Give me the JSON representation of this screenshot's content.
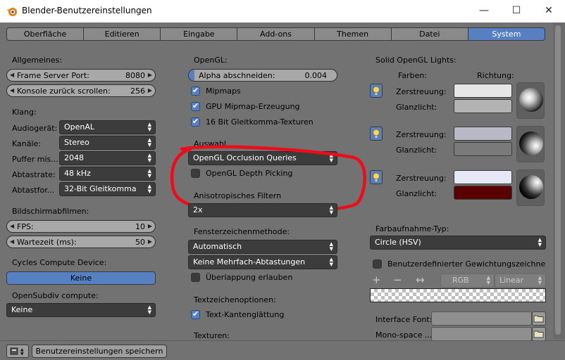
{
  "window": {
    "title": "Blender-Benutzereinstellungen",
    "minimize": "—",
    "maximize": "☐",
    "close": "✕"
  },
  "tabs": [
    "Oberfläche",
    "Editieren",
    "Eingabe",
    "Add-ons",
    "Themen",
    "Datei",
    "System"
  ],
  "active_tab": "System",
  "left": {
    "general_heading": "Allgemeines:",
    "frame_server_port": {
      "label": "Frame Server Port:",
      "value": "8080"
    },
    "console_scroll": {
      "label": "Konsole zurück scrollen:",
      "value": "256"
    },
    "sound_heading": "Klang:",
    "audio_device": {
      "label": "Audiogerät:",
      "value": "OpenAL"
    },
    "channels": {
      "label": "Kanäle:",
      "value": "Stereo"
    },
    "buffer": {
      "label": "Puffer mis...",
      "value": "2048"
    },
    "sample_rate": {
      "label": "Abtastrate:",
      "value": "48 kHz"
    },
    "sample_format": {
      "label": "Abtastfor...",
      "value": "32-Bit Gleitkomma"
    },
    "screencast_heading": "Bildschirmabfilmen:",
    "fps": {
      "label": "FPS:",
      "value": "10"
    },
    "wait_time": {
      "label": "Wartezeit (ms):",
      "value": "50"
    },
    "cycles_heading": "Cycles Compute Device:",
    "cycles_button": "Keine",
    "opensubdiv_heading": "OpenSubdiv compute:",
    "opensubdiv_value": "Keine"
  },
  "middle": {
    "opengl_heading": "OpenGL:",
    "alpha_clip": {
      "label": "Alpha abschneiden:",
      "value": "0.004"
    },
    "mipmaps": "Mipmaps",
    "gpu_mipmap": "GPU Mipmap-Erzeugung",
    "float_textures": "16 Bit Gleitkomma-Texturen",
    "selection_heading": "Auswahl",
    "selection_value": "OpenGL Occlusion Queries",
    "depth_picking": "OpenGL Depth Picking",
    "aniso_heading": "Anisotropisches Filtern",
    "aniso_value": "2x",
    "window_draw_heading": "Fensterzeichenmethode:",
    "window_draw_value": "Automatisch",
    "multisample_value": "Keine Mehrfach-Abtastungen",
    "overlap": "Überlappung erlauben",
    "text_draw_heading": "Textzeichenoptionen:",
    "text_antialias": "Text-Kantenglättung",
    "textures_heading": "Texturen:"
  },
  "right": {
    "solid_lights_heading": "Solid OpenGL Lights:",
    "colors_label": "Farben:",
    "direction_label": "Richtung:",
    "diffuse_label": "Zerstreuung:",
    "specular_label": "Glanzlicht:",
    "lights": [
      {
        "diffuse": "#e6e6e6",
        "specular": "#b3b3b3"
      },
      {
        "diffuse": "#b8b8c6",
        "specular": "#7a7a7a"
      },
      {
        "diffuse": "#e6e8f8",
        "specular": "#5a0000"
      }
    ],
    "color_picker_heading": "Farbaufnahme-Typ:",
    "color_picker_value": "Circle (HSV)",
    "custom_weight": "Benutzerdefinierter Gewichtungszeichnen-B...",
    "plus": "+",
    "minus": "−",
    "arrows": "↔",
    "rgb": "RGB",
    "linear": "Linear",
    "interface_font": "Interface Font:",
    "monospace_font": "Mono-space ..."
  },
  "footer": {
    "save_button": "Benutzereinstellungen speichern"
  },
  "colors": {
    "accent": "#5680c2",
    "panel": "#727272",
    "field_dark": "#3c3c3c",
    "field_light": "#a8a8a8"
  }
}
